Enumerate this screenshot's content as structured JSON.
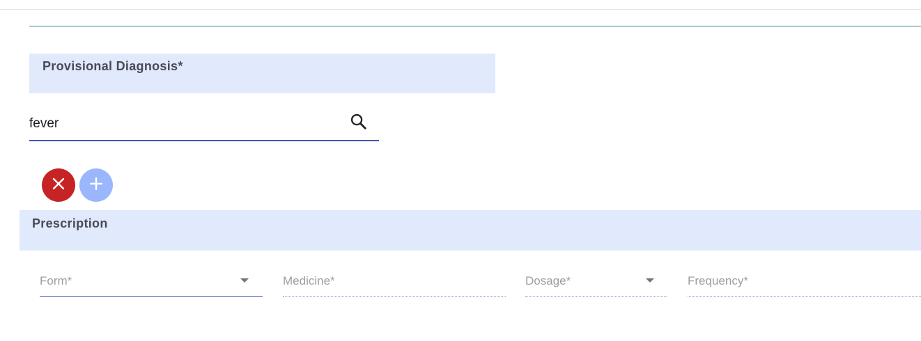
{
  "provisional_diagnosis": {
    "heading": "Provisional Diagnosis*",
    "input_value": "fever",
    "search_icon": "search-icon"
  },
  "actions": {
    "remove_icon": "close-icon",
    "add_icon": "plus-icon",
    "remove_color": "#c62424",
    "add_color": "#9ab7fd"
  },
  "prescription": {
    "heading": "Prescription",
    "fields": {
      "form": "Form*",
      "medicine": "Medicine*",
      "dosage": "Dosage*",
      "frequency": "Frequency*"
    }
  },
  "colors": {
    "section_header_bg": "#e1e9fd",
    "accent": "#3e55b5",
    "teal_rule": "#3a7d96"
  }
}
